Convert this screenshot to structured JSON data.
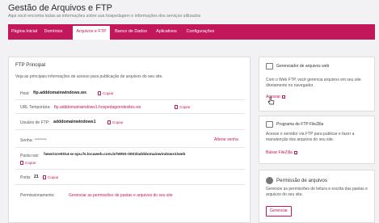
{
  "header": {
    "title": "Gestão de Arquivos e FTP",
    "subtitle": "Aqui você encontra todas as informações sobre sua hospedagem e informações dos serviços utilizados"
  },
  "nav": {
    "items": [
      "Página Inicial",
      "Domínios",
      "Arquivos e FTP",
      "Banco de Dados",
      "Aplicativos",
      "Configurações"
    ],
    "active": "Arquivos e FTP"
  },
  "ftp": {
    "title": "FTP Principal",
    "description": "Veja as principais informações de acesso para publicação de arquivos do seu site.",
    "copy_label": "Copiar",
    "change_password_label": "Alterar senha",
    "rows": {
      "host_label": "Host:",
      "host_value": "ftp.adddomainwindows.ws",
      "url_label": "URL Temporária:",
      "url_value": "ftp.adddomainwindows1.hospedagemdesites.ws",
      "user_label": "Usuário de FTP:",
      "user_value": "adddomainwindows1",
      "password_label": "Senha:",
      "password_value": "••••••••",
      "path_label": "Pasta raiz:",
      "path_value": "\\\\wwriore0014-w-spu.fs.locaweb.com.br\\WNS-0003\\adddomainwindows1\\web",
      "port_label": "Porta:",
      "port_value": "21",
      "perm_label": "Permissionamento:",
      "perm_value": "Gerenciar as permissões de pastas e arquivos do seu site"
    }
  },
  "webftp": {
    "title": "Gerenciador de arquivos web",
    "description": "Com o Web FTP, você gerencia arquivos em seu site diretamente no navegador.",
    "link": "Acessar"
  },
  "filezilla": {
    "title": "Programa de FTP FileZilla",
    "description": "Acesse o servidor via FTP para publicar e fazer a manutenção dos arquivos do seu site.",
    "link": "Baixar FileZilla"
  },
  "permissions": {
    "title": "Permissão de arquivos",
    "description": "Gerencie as permissões de leitura e escrita das pastas e arquivos do seu site.",
    "button": "Gerenciar"
  }
}
